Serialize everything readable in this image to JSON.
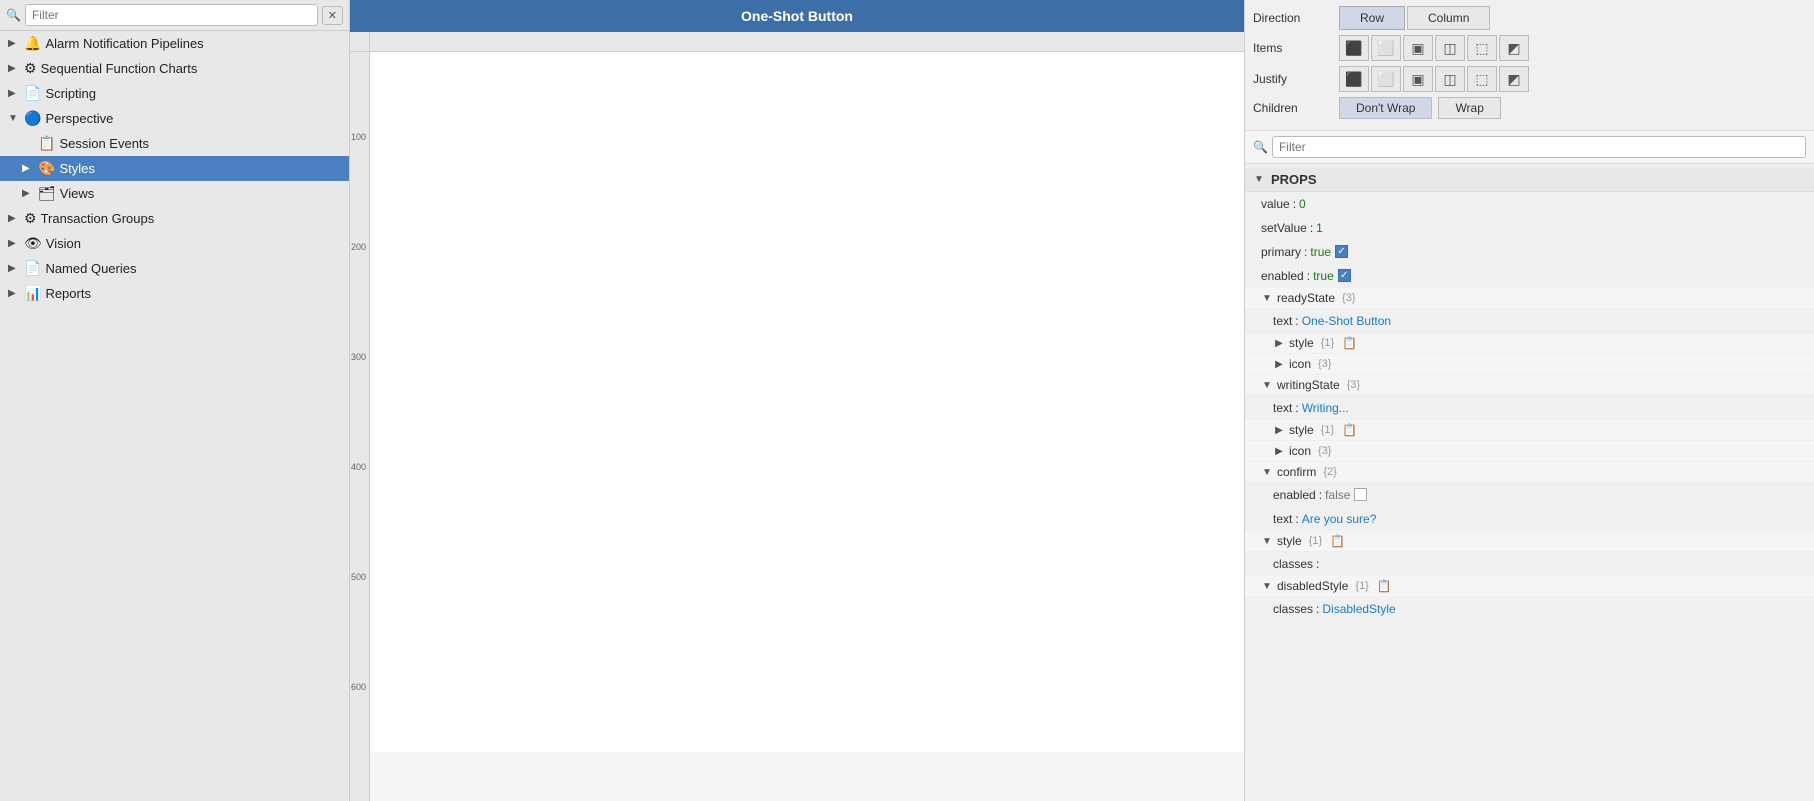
{
  "sidebar": {
    "filter_placeholder": "Filter",
    "items": [
      {
        "id": "alarm-pipelines",
        "label": "Alarm Notification Pipelines",
        "icon": "🔔",
        "indent": 0,
        "toggle": "▶",
        "selected": false
      },
      {
        "id": "sfc",
        "label": "Sequential Function Charts",
        "icon": "⚙",
        "indent": 0,
        "toggle": "▶",
        "selected": false
      },
      {
        "id": "scripting",
        "label": "Scripting",
        "icon": "📄",
        "indent": 0,
        "toggle": "▶",
        "selected": false
      },
      {
        "id": "perspective",
        "label": "Perspective",
        "icon": "🔵",
        "indent": 0,
        "toggle": "▼",
        "selected": false
      },
      {
        "id": "session-events",
        "label": "Session Events",
        "icon": "📋",
        "indent": 1,
        "toggle": "",
        "selected": false
      },
      {
        "id": "styles",
        "label": "Styles",
        "icon": "🎨",
        "indent": 1,
        "toggle": "▶",
        "selected": true
      },
      {
        "id": "views",
        "label": "Views",
        "icon": "🗂",
        "indent": 1,
        "toggle": "▶",
        "selected": false
      },
      {
        "id": "transaction-groups",
        "label": "Transaction Groups",
        "icon": "⚙",
        "indent": 0,
        "toggle": "▶",
        "selected": false
      },
      {
        "id": "vision",
        "label": "Vision",
        "icon": "👁",
        "indent": 0,
        "toggle": "▶",
        "selected": false
      },
      {
        "id": "named-queries",
        "label": "Named Queries",
        "icon": "📄",
        "indent": 0,
        "toggle": "▶",
        "selected": false
      },
      {
        "id": "reports",
        "label": "Reports",
        "icon": "📊",
        "indent": 0,
        "toggle": "▶",
        "selected": false
      }
    ]
  },
  "canvas": {
    "title": "One-Shot Button",
    "ruler_marks": [
      "100",
      "200",
      "300",
      "400",
      "500",
      "600"
    ]
  },
  "right_panel": {
    "direction": {
      "label": "Direction",
      "options": [
        "Row",
        "Column"
      ]
    },
    "items": {
      "label": "Items"
    },
    "justify": {
      "label": "Justify"
    },
    "children": {
      "label": "Children",
      "options": [
        "Don't Wrap",
        "Wrap"
      ],
      "active": "Don't Wrap"
    },
    "filter_placeholder": "Filter",
    "props_header": "PROPS",
    "properties": [
      {
        "key": "value",
        "colon": ":",
        "value": "0",
        "type": "number",
        "indent": 1
      },
      {
        "key": "setValue",
        "colon": ":",
        "value": "1",
        "type": "number",
        "indent": 1
      },
      {
        "key": "primary",
        "colon": ":",
        "value": "true",
        "type": "boolean-true",
        "checkbox": true,
        "checked": true,
        "indent": 1
      },
      {
        "key": "enabled",
        "colon": ":",
        "value": "true",
        "type": "boolean-true",
        "checkbox": true,
        "checked": true,
        "indent": 1
      },
      {
        "key": "readyState",
        "count": "{3}",
        "indent": 1,
        "section": true,
        "expanded": true
      },
      {
        "key": "text",
        "colon": ":",
        "value": "One-Shot Button",
        "type": "string-val",
        "indent": 2
      },
      {
        "key": "style",
        "count": "{1}",
        "indent": 2,
        "section": true,
        "expanded": false,
        "paste": true
      },
      {
        "key": "icon",
        "count": "{3}",
        "indent": 2,
        "section": true,
        "expanded": false
      },
      {
        "key": "writingState",
        "count": "{3}",
        "indent": 1,
        "section": true,
        "expanded": true
      },
      {
        "key": "text",
        "colon": ":",
        "value": "Writing...",
        "type": "string-val",
        "indent": 2
      },
      {
        "key": "style",
        "count": "{1}",
        "indent": 2,
        "section": true,
        "expanded": false,
        "paste": true
      },
      {
        "key": "icon",
        "count": "{3}",
        "indent": 2,
        "section": true,
        "expanded": false
      },
      {
        "key": "confirm",
        "count": "{2}",
        "indent": 1,
        "section": true,
        "expanded": true
      },
      {
        "key": "enabled",
        "colon": ":",
        "value": "false",
        "type": "boolean-false",
        "checkbox": true,
        "checked": false,
        "indent": 2
      },
      {
        "key": "text",
        "colon": ":",
        "value": "Are you sure?",
        "type": "string-val",
        "indent": 2
      },
      {
        "key": "style",
        "count": "{1}",
        "indent": 1,
        "section": true,
        "expanded": true,
        "paste": true
      },
      {
        "key": "classes",
        "colon": ":",
        "value": "",
        "type": "string-val",
        "indent": 2
      },
      {
        "key": "disabledStyle",
        "count": "{1}",
        "indent": 1,
        "section": true,
        "expanded": true,
        "paste": true
      },
      {
        "key": "classes",
        "colon": ":",
        "value": "DisabledStyle",
        "type": "string-val",
        "indent": 2
      }
    ]
  }
}
